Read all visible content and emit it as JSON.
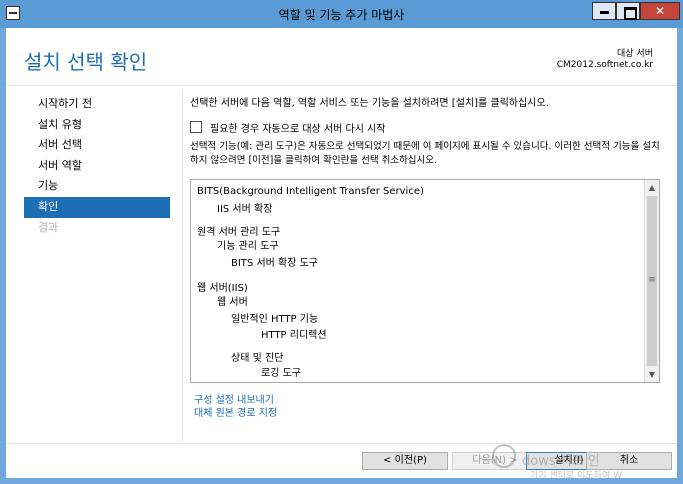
{
  "window": {
    "title": "역할 및 기능 추가 마법사"
  },
  "header": {
    "page_title": "설치 선택 확인",
    "dest_label": "대상 서버",
    "dest_server": "CM2012.softnet.co.kr"
  },
  "nav": {
    "items": [
      {
        "label": "시작하기 전",
        "state": "normal"
      },
      {
        "label": "설치 유형",
        "state": "normal"
      },
      {
        "label": "서버 선택",
        "state": "normal"
      },
      {
        "label": "서버 역할",
        "state": "normal"
      },
      {
        "label": "기능",
        "state": "normal"
      },
      {
        "label": "확인",
        "state": "selected"
      },
      {
        "label": "결과",
        "state": "disabled"
      }
    ]
  },
  "content": {
    "intro": "선택한 서버에 다음 역할, 역할 서비스 또는 기능을 설치하려면 [설치]를 클릭하십시오.",
    "restart_checkbox": {
      "label": "필요한 경우 자동으로 대상 서버 다시 시작",
      "checked": false
    },
    "note": "선택적 기능(예: 관리 도구)은 자동으로 선택되었기 때문에 이 페이지에 표시될 수 있습니다. 이러한 선택적 기능을 설치하지 않으려면 [이전]을 클릭하여 확인란을 선택 취소하십시오.",
    "features": [
      {
        "text": "BITS(Background Intelligent Transfer Service)",
        "level": 0
      },
      {
        "text": "IIS 서버 확장",
        "level": 1
      },
      {
        "text": "원격 서버 관리 도구",
        "level": 0
      },
      {
        "text": "기능 관리 도구",
        "level": 1
      },
      {
        "text": "BITS 서버 확장 도구",
        "level": 2
      },
      {
        "text": "웹 서버(IIS)",
        "level": 0
      },
      {
        "text": "웹 서버",
        "level": 1
      },
      {
        "text": "일반적인 HTTP 기능",
        "level": 2
      },
      {
        "text": "HTTP 리디렉션",
        "level": 3
      },
      {
        "text": "상태 및 진단",
        "level": 2
      },
      {
        "text": "로깅 도구",
        "level": 3
      }
    ],
    "links": {
      "export": "구성 설정 내보내기",
      "alt_source": "대체 원본 경로 지정"
    }
  },
  "footer": {
    "prev": "< 이전(P)",
    "next": "다음(N) >",
    "install": "설치(I)",
    "cancel": "취소"
  },
  "watermark": {
    "line1": "dows 서포 인",
    "line2": "기기 센터로 이도하여 W"
  },
  "colors": {
    "title_bar": "#5b9bd5",
    "accent": "#1e6eb5",
    "close_button": "#c7463b"
  },
  "icons": {
    "app": "server-manager-icon",
    "minimize": "minimize-icon",
    "maximize": "maximize-icon",
    "close": "close-icon"
  }
}
